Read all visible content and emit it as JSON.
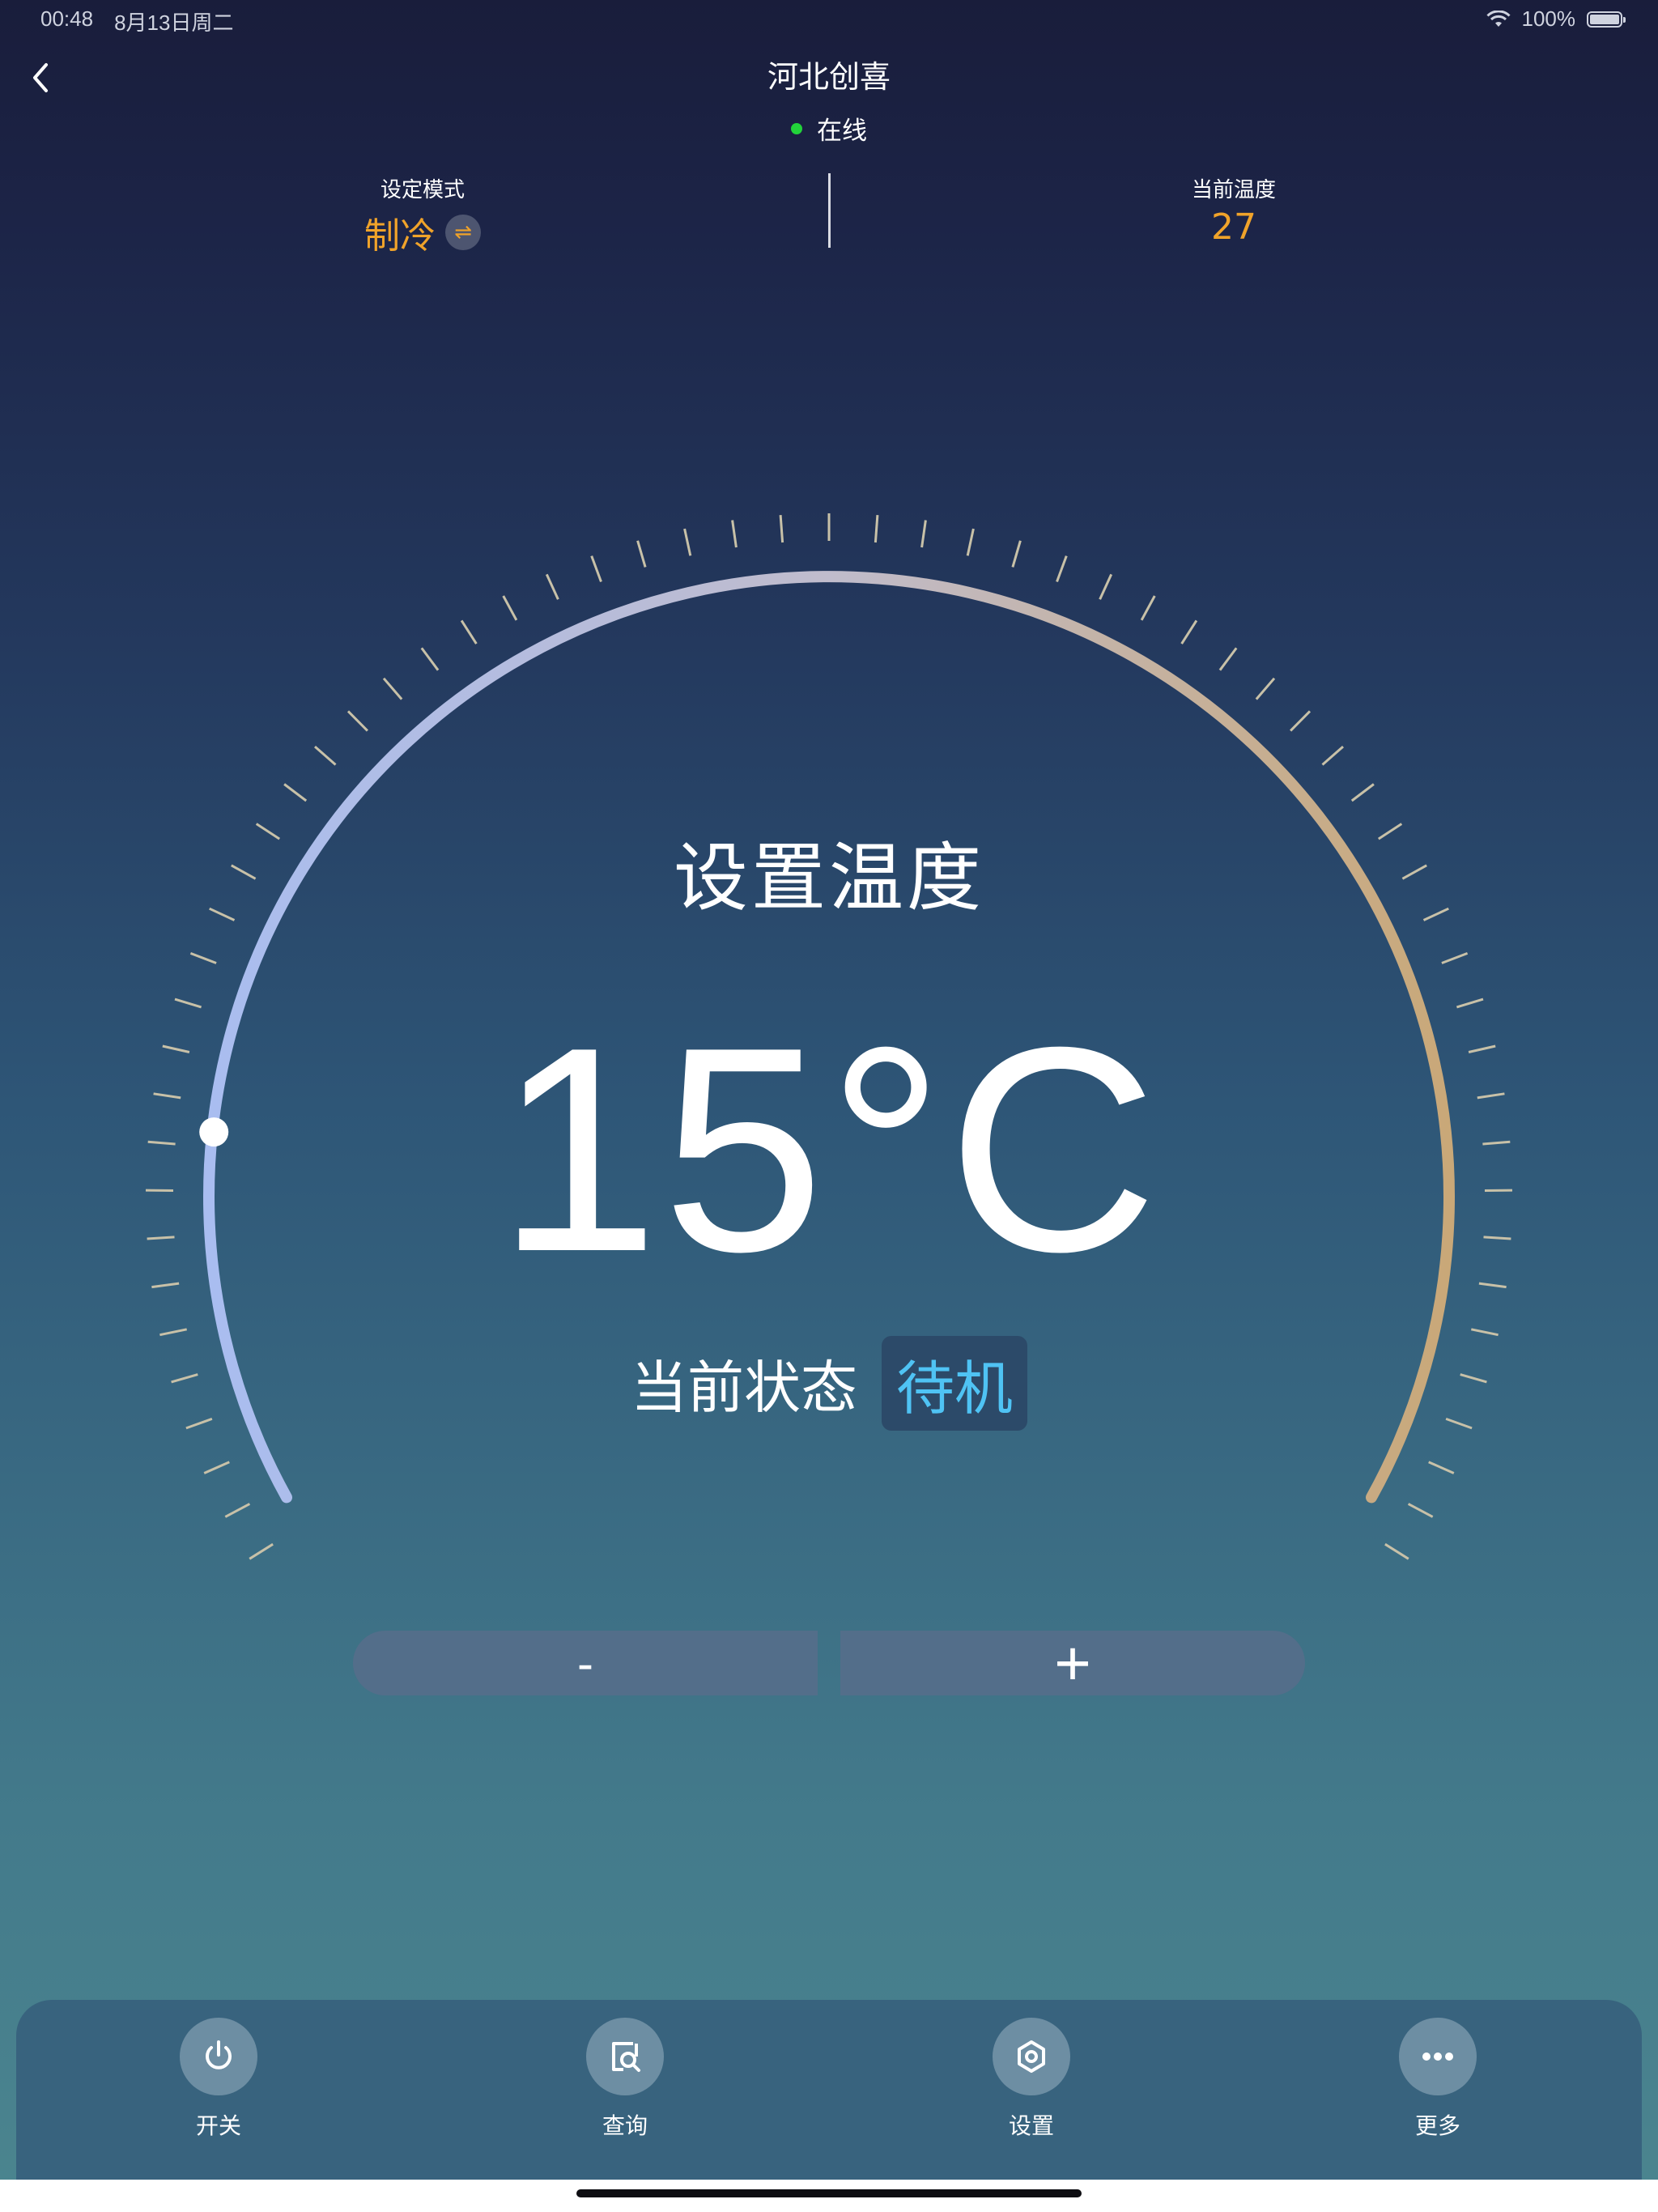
{
  "status_bar": {
    "time": "00:48",
    "date": "8月13日周二",
    "battery": "100%"
  },
  "header": {
    "title": "河北创喜",
    "online_status": "在线",
    "online_color": "#22d33a"
  },
  "info": {
    "mode_label": "设定模式",
    "mode_value": "制冷",
    "current_temp_label": "当前温度",
    "current_temp_value": "27",
    "accent_color": "#f0a32a"
  },
  "dial": {
    "label": "设置温度",
    "set_temperature": "15°C",
    "state_label": "当前状态",
    "state_value": "待机",
    "state_color": "#4fc3f4",
    "gradient_start": "#a9bdf0",
    "gradient_end": "#c9a878"
  },
  "stepper": {
    "minus_label": "-",
    "plus_label": "+"
  },
  "bottom_nav": [
    {
      "label": "开关",
      "icon": "power-icon"
    },
    {
      "label": "查询",
      "icon": "query-icon"
    },
    {
      "label": "设置",
      "icon": "settings-icon"
    },
    {
      "label": "更多",
      "icon": "more-icon"
    }
  ]
}
